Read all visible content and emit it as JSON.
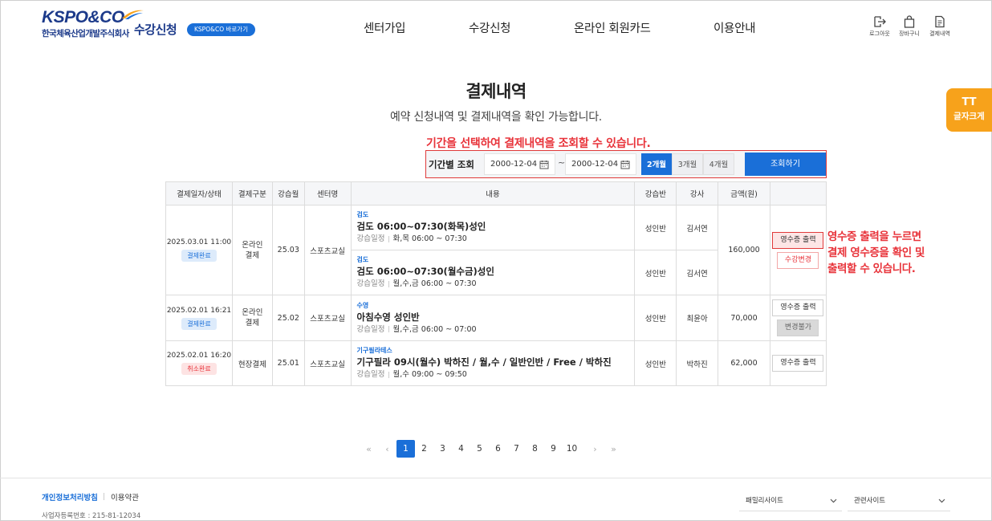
{
  "header": {
    "logo_text": "KSPO&CO",
    "logo_sub": "한국체육산업개발주식회사",
    "brand_title": "수강신청",
    "brand_button": "KSPO&CO 바로가기",
    "nav": [
      "센터가입",
      "수강신청",
      "온라인 회원카드",
      "이용안내"
    ],
    "utils": [
      {
        "label": "로그아웃",
        "icon": "logout-icon"
      },
      {
        "label": "장바구니",
        "icon": "bag-icon"
      },
      {
        "label": "결제내역",
        "icon": "document-icon"
      }
    ]
  },
  "font_size_button": {
    "icon": "TT",
    "label": "글자크게"
  },
  "page": {
    "title": "결제내역",
    "description": "예약 신청내역 및 결제내역을 확인 가능합니다."
  },
  "annotations": {
    "period_hint": "기간을 선택하여 결제내역을 조회할 수 있습니다.",
    "receipt_hint": [
      "영수증 출력을 누르면",
      "결제 영수증을 확인 및",
      "출력할 수 있습니다."
    ]
  },
  "filter": {
    "label": "기간별 조회",
    "start_date": "2000-12-04",
    "end_date": "2000-12-04",
    "separator": "~",
    "periods": [
      "2개월",
      "3개월",
      "4개월"
    ],
    "active_period": "2개월",
    "search_label": "조회하기"
  },
  "table": {
    "headers": [
      "결제일자/상태",
      "결제구분",
      "강습월",
      "센터명",
      "내용",
      "강습반",
      "강사",
      "금액(원)",
      ""
    ],
    "schedule_key": "강습일정",
    "orders": [
      {
        "date": "2025.03.01 11:00",
        "status": "결제완료",
        "pay_type": "온라인\n결제",
        "month": "25.03",
        "center": "스포츠교실",
        "amount": "160,000",
        "buttons": [
          "영수증 출력",
          "수강변경"
        ],
        "items": [
          {
            "category": "검도",
            "title": "검도 06:00~07:30(화목)성인",
            "schedule": "화,목 06:00 ~ 07:30",
            "class": "성인반",
            "teacher": "김서연"
          },
          {
            "category": "검도",
            "title": "검도 06:00~07:30(월수금)성인",
            "schedule": "월,수,금 06:00 ~ 07:30",
            "class": "성인반",
            "teacher": "김서연"
          }
        ]
      },
      {
        "date": "2025.02.01 16:21",
        "status": "결제완료",
        "pay_type": "온라인\n결제",
        "month": "25.02",
        "center": "스포츠교실",
        "amount": "70,000",
        "buttons": [
          "영수증 출력",
          "변경불가"
        ],
        "items": [
          {
            "category": "수영",
            "title": "아침수영 성인반",
            "schedule": "월,수,금 06:00 ~ 07:00",
            "class": "성인반",
            "teacher": "최윤아"
          }
        ]
      },
      {
        "date": "2025.02.01 16:20",
        "status": "취소완료",
        "pay_type": "현장결제",
        "month": "25.01",
        "center": "스포츠교실",
        "amount": "62,000",
        "buttons": [
          "영수증 출력"
        ],
        "items": [
          {
            "category": "기구필라테스",
            "title": "기구필라 09시(월수) 박하진 / 월,수 / 일반인반 / Free / 박하진",
            "schedule": "월,수 09:00 ~ 09:50",
            "class": "성인반",
            "teacher": "박하진"
          }
        ]
      }
    ]
  },
  "pagination": {
    "pages": [
      "1",
      "2",
      "3",
      "4",
      "5",
      "6",
      "7",
      "8",
      "9",
      "10"
    ],
    "current": "1",
    "first": "«",
    "prev": "‹",
    "next": "›",
    "last": "»"
  },
  "footer": {
    "privacy": "개인정보처리방침",
    "terms": "이용약관",
    "business_no": "사업자등록번호 : 215-81-12034",
    "family_site": "패밀리사이트",
    "related_site": "관련사이트"
  },
  "colors": {
    "primary": "#1a6fd8",
    "navy": "#1c3a8a",
    "annotation": "#e8333a",
    "float": "#f7a21b"
  }
}
